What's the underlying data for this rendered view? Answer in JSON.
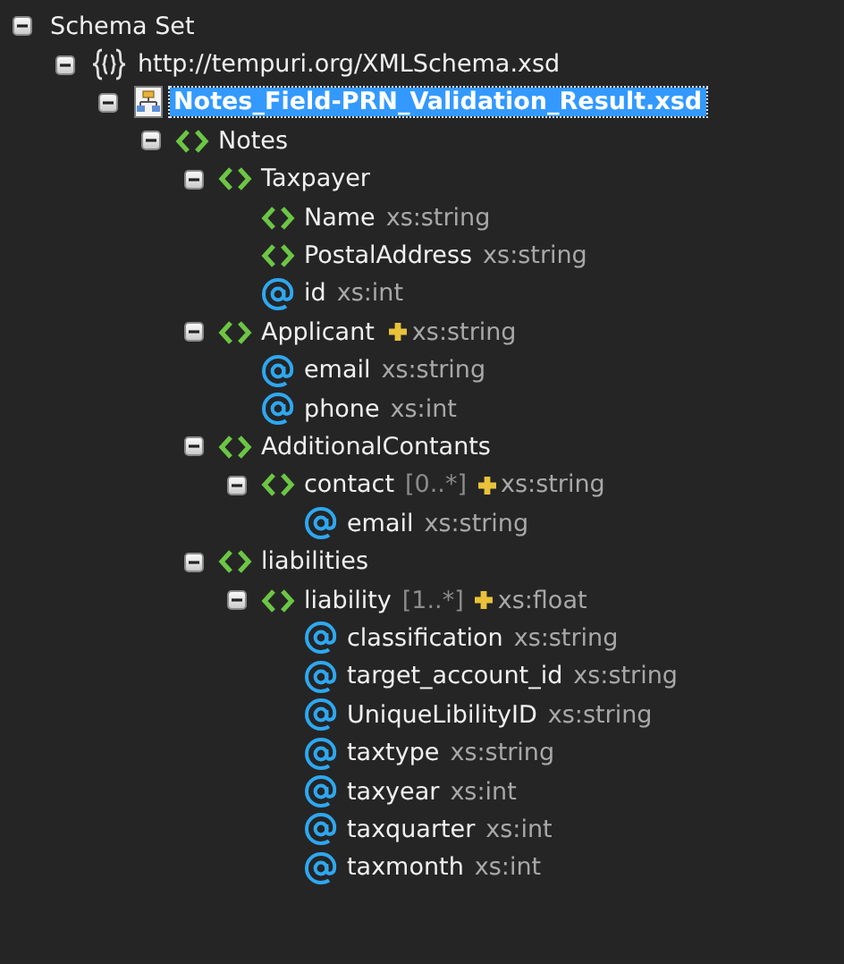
{
  "tree": [
    {
      "label": "Schema Set",
      "expanded": true,
      "selected": false,
      "children": [
        {
          "kind": "namespace",
          "label": "http://tempuri.org/XMLSchema.xsd",
          "expanded": true,
          "selected": false,
          "children": [
            {
              "kind": "file",
              "label": "Notes_Field-PRN_Validation_Result.xsd",
              "expanded": true,
              "selected": true,
              "children": [
                {
                  "kind": "element",
                  "label": "Notes",
                  "expanded": true,
                  "selected": false,
                  "children": [
                    {
                      "kind": "element",
                      "label": "Taxpayer",
                      "expanded": true,
                      "selected": false,
                      "children": [
                        {
                          "kind": "element",
                          "label": "Name",
                          "type": "xs:string",
                          "selected": false
                        },
                        {
                          "kind": "element",
                          "label": "PostalAddress",
                          "type": "xs:string",
                          "selected": false
                        },
                        {
                          "kind": "attribute",
                          "label": "id",
                          "type": "xs:int",
                          "selected": false
                        }
                      ]
                    },
                    {
                      "kind": "element",
                      "label": "Applicant",
                      "type": "xs:string",
                      "simple_content": true,
                      "expanded": true,
                      "selected": false,
                      "children": [
                        {
                          "kind": "attribute",
                          "label": "email",
                          "type": "xs:string",
                          "selected": false
                        },
                        {
                          "kind": "attribute",
                          "label": "phone",
                          "type": "xs:int",
                          "selected": false
                        }
                      ]
                    },
                    {
                      "kind": "element",
                      "label": "AdditionalContants",
                      "expanded": true,
                      "selected": false,
                      "children": [
                        {
                          "kind": "element",
                          "label": "contact",
                          "multiplicity": "[0..*]",
                          "type": "xs:string",
                          "simple_content": true,
                          "expanded": true,
                          "selected": false,
                          "children": [
                            {
                              "kind": "attribute",
                              "label": "email",
                              "type": "xs:string",
                              "selected": false
                            }
                          ]
                        }
                      ]
                    },
                    {
                      "kind": "element",
                      "label": "liabilities",
                      "expanded": true,
                      "selected": false,
                      "children": [
                        {
                          "kind": "element",
                          "label": "liability",
                          "multiplicity": "[1..*]",
                          "type": "xs:float",
                          "simple_content": true,
                          "expanded": true,
                          "selected": false,
                          "children": [
                            {
                              "kind": "attribute",
                              "label": "classification",
                              "type": "xs:string",
                              "selected": false
                            },
                            {
                              "kind": "attribute",
                              "label": "target_account_id",
                              "type": "xs:string",
                              "selected": false
                            },
                            {
                              "kind": "attribute",
                              "label": "UniqueLibilityID",
                              "type": "xs:string",
                              "selected": false
                            },
                            {
                              "kind": "attribute",
                              "label": "taxtype",
                              "type": "xs:string",
                              "selected": false
                            },
                            {
                              "kind": "attribute",
                              "label": "taxyear",
                              "type": "xs:int",
                              "selected": false
                            },
                            {
                              "kind": "attribute",
                              "label": "taxquarter",
                              "type": "xs:int",
                              "selected": false
                            },
                            {
                              "kind": "attribute",
                              "label": "taxmonth",
                              "type": "xs:int",
                              "selected": false
                            }
                          ]
                        }
                      ]
                    }
                  ]
                }
              ]
            }
          ]
        }
      ]
    }
  ]
}
